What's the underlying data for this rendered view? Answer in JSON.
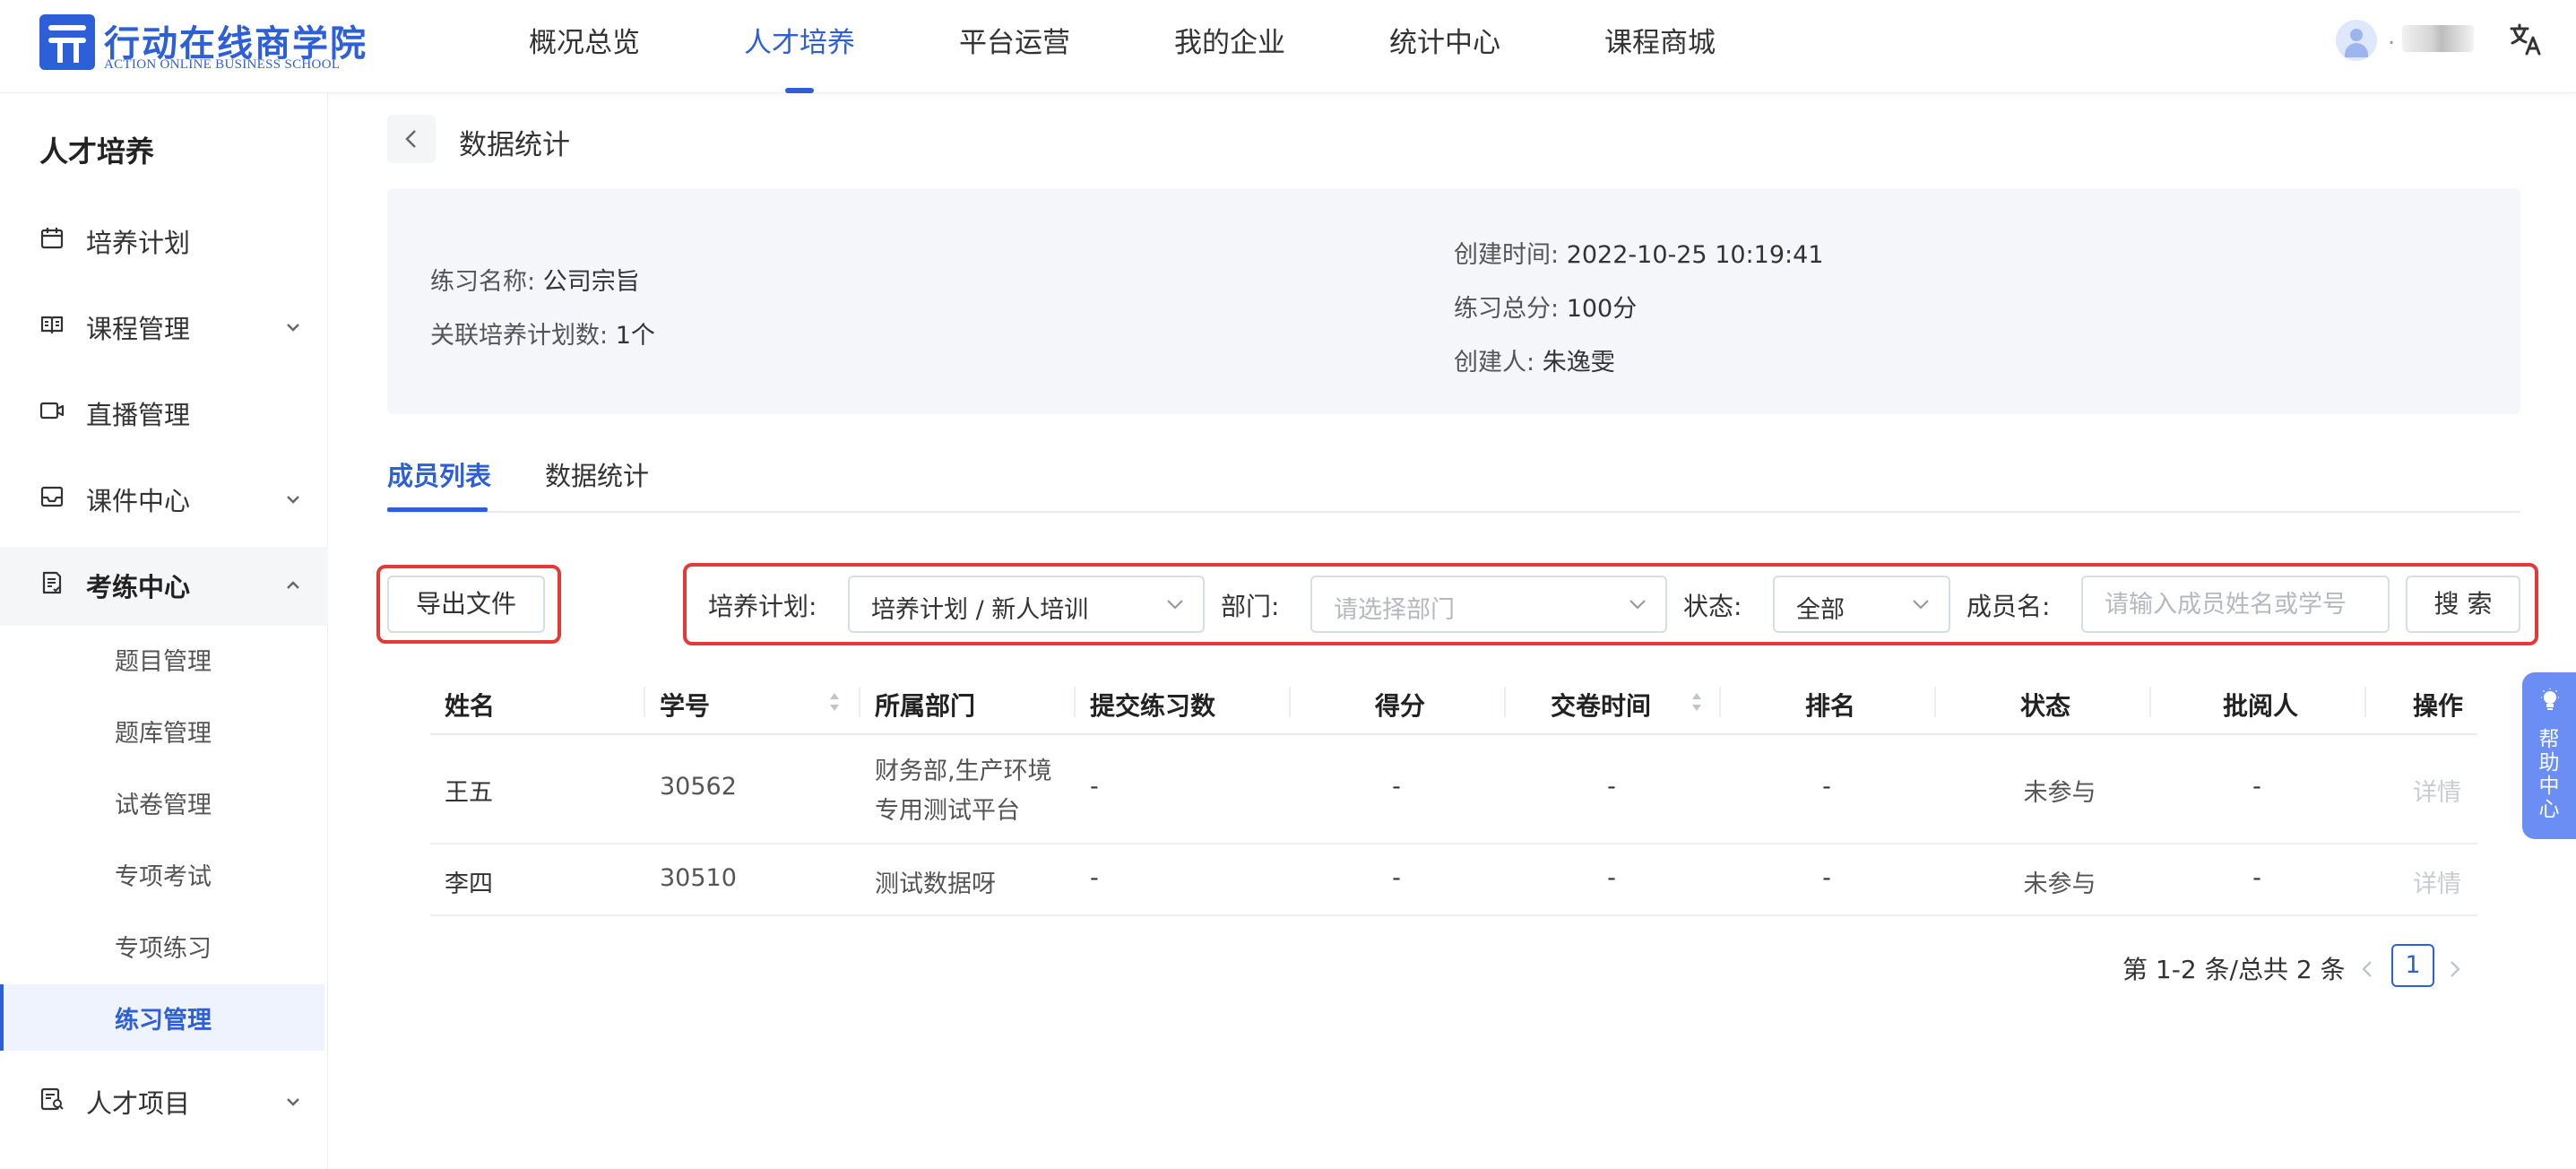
{
  "brand": {
    "name_cn": "行动在线商学院",
    "name_en": "ACTION ONLINE BUSINESS SCHOOL",
    "color": "#2d5fd9"
  },
  "topnav": {
    "items": [
      "概况总览",
      "人才培养",
      "平台运营",
      "我的企业",
      "统计中心",
      "课程商城"
    ],
    "active": "人才培养"
  },
  "user": {
    "name_prefix": "."
  },
  "sidebar": {
    "title": "人才培养",
    "items": [
      {
        "label": "培养计划",
        "icon": "calendar-icon"
      },
      {
        "label": "课程管理",
        "icon": "book-icon"
      },
      {
        "label": "直播管理",
        "icon": "video-icon"
      },
      {
        "label": "课件中心",
        "icon": "inbox-icon"
      },
      {
        "label": "考练中心",
        "icon": "exam-icon"
      },
      {
        "label": "人才项目",
        "icon": "project-icon"
      }
    ],
    "subitems": [
      "题目管理",
      "题库管理",
      "试卷管理",
      "专项考试",
      "专项练习",
      "练习管理"
    ],
    "active_sub": "练习管理"
  },
  "page": {
    "title": "数据统计"
  },
  "info": {
    "practice_name_label": "练习名称:",
    "practice_name": "公司宗旨",
    "plan_count_label": "关联培养计划数:",
    "plan_count": "1个",
    "created_label": "创建时间:",
    "created": "2022-10-25 10:19:41",
    "total_label": "练习总分:",
    "total": "100分",
    "creator_label": "创建人:",
    "creator": "朱逸雯"
  },
  "tabs": [
    "成员列表",
    "数据统计"
  ],
  "filters": {
    "export_label": "导出文件",
    "plan_label": "培养计划:",
    "plan_value": "培养计划 / 新人培训",
    "dept_label": "部门:",
    "dept_placeholder": "请选择部门",
    "status_label": "状态:",
    "status_value": "全部",
    "member_label": "成员名:",
    "member_placeholder": "请输入成员姓名或学号",
    "search_label": "搜 索"
  },
  "table": {
    "columns": [
      "姓名",
      "学号",
      "所属部门",
      "提交练习数",
      "得分",
      "交卷时间",
      "排名",
      "状态",
      "批阅人",
      "操作"
    ],
    "rows": [
      {
        "name": "王五",
        "id": "30562",
        "dept_line1": "财务部,生产环境",
        "dept_line2": "专用测试平台",
        "submit": "-",
        "score": "-",
        "time": "-",
        "rank": "-",
        "status": "未参与",
        "reviewer": "-",
        "action": "详情"
      },
      {
        "name": "李四",
        "id": "30510",
        "dept_line1": "测试数据呀",
        "dept_line2": "",
        "submit": "-",
        "score": "-",
        "time": "-",
        "rank": "-",
        "status": "未参与",
        "reviewer": "-",
        "action": "详情"
      }
    ]
  },
  "pagination": {
    "total_text": "第 1-2 条/总共 2 条",
    "current": "1"
  },
  "help": {
    "label": "帮助中心"
  }
}
